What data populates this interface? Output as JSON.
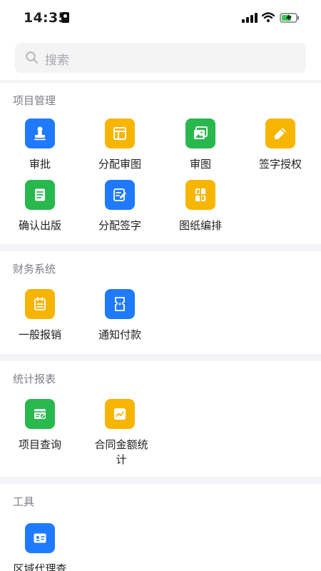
{
  "status_bar": {
    "time": "14:35",
    "icons": [
      "id-card-icon",
      "cellular-signal-icon",
      "wifi-icon",
      "battery-charging-icon"
    ]
  },
  "search": {
    "placeholder": "搜索",
    "icon": "search-icon"
  },
  "colors": {
    "blue": "#1f7aff",
    "yellow": "#f7b500",
    "green": "#29b84e",
    "background": "#f3f4f7",
    "section_title": "#7d7f86"
  },
  "sections": [
    {
      "title": "项目管理",
      "items": [
        {
          "label": "审批",
          "icon": "stamp-icon",
          "color": "blue"
        },
        {
          "label": "分配审图",
          "icon": "layout-icon",
          "color": "yellow"
        },
        {
          "label": "审图",
          "icon": "image-gallery-icon",
          "color": "green"
        },
        {
          "label": "签字授权",
          "icon": "pencil-icon",
          "color": "yellow"
        },
        {
          "label": "确认出版",
          "icon": "document-list-icon",
          "color": "green"
        },
        {
          "label": "分配签字",
          "icon": "edit-note-icon",
          "color": "blue"
        },
        {
          "label": "图纸编排",
          "icon": "drawing-layout-icon",
          "color": "yellow"
        }
      ]
    },
    {
      "title": "财务系统",
      "items": [
        {
          "label": "一般报销",
          "icon": "calendar-receipt-icon",
          "color": "yellow"
        },
        {
          "label": "通知付款",
          "icon": "yuan-ticket-icon",
          "color": "blue"
        }
      ]
    },
    {
      "title": "统计报表",
      "items": [
        {
          "label": "项目查询",
          "icon": "project-search-icon",
          "color": "green"
        },
        {
          "label": "合同金额统计",
          "icon": "trend-chart-icon",
          "color": "yellow"
        }
      ]
    },
    {
      "title": "工具",
      "items": [
        {
          "label": "区域代理查",
          "icon": "contact-card-icon",
          "color": "blue"
        }
      ]
    }
  ]
}
